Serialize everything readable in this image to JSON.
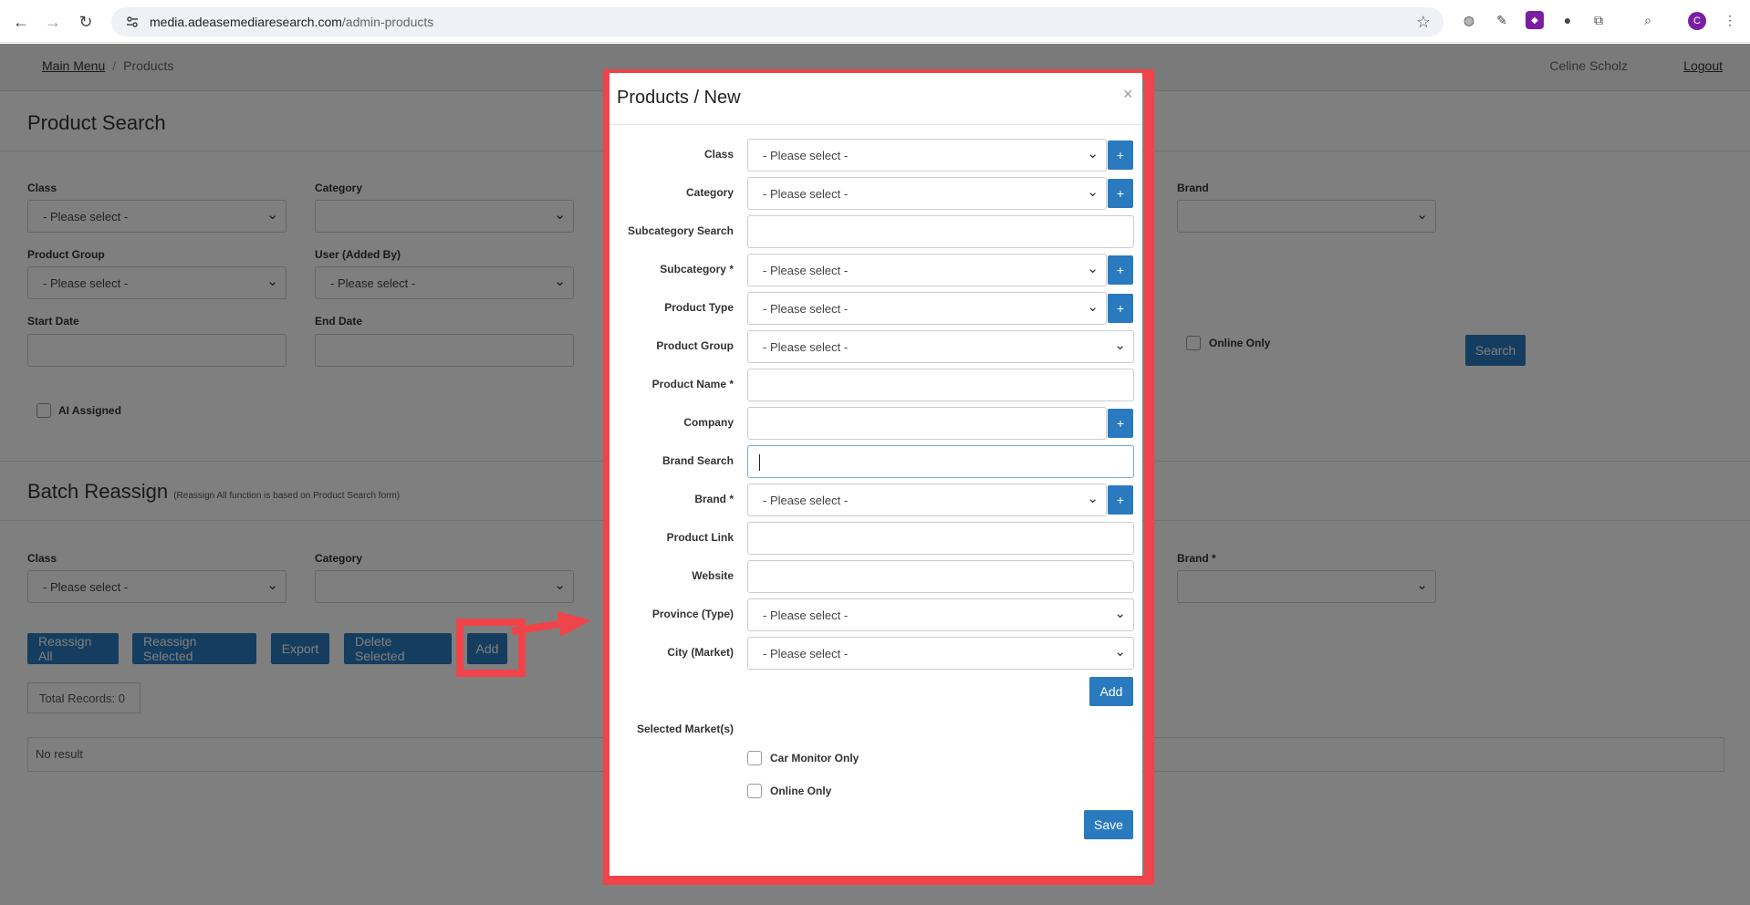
{
  "browser": {
    "url_host": "media.adeasemediaresearch.com",
    "url_path": "/admin-products",
    "avatar_letter": "C"
  },
  "topnav": {
    "main_menu": "Main Menu",
    "current": "Products",
    "user": "Celine Scholz",
    "logout": "Logout"
  },
  "product_search": {
    "title": "Product Search",
    "class_label": "Class",
    "class_value": "- Please select -",
    "category_label": "Category",
    "brand_label": "Brand",
    "product_group_label": "Product Group",
    "product_group_value": "- Please select -",
    "user_label": "User (Added By)",
    "user_value": "- Please select -",
    "start_date_label": "Start Date",
    "end_date_label": "End Date",
    "online_only": "Online Only",
    "search_button": "Search",
    "ai_assigned": "AI Assigned"
  },
  "batch_reassign": {
    "title": "Batch Reassign",
    "subtitle": "(Reassign All function is based on Product Search form)",
    "class_label": "Class",
    "class_value": "- Please select -",
    "category_label": "Category",
    "brand_label": "Brand *",
    "reassign_all": "Reassign All",
    "reassign_selected": "Reassign Selected",
    "export": "Export",
    "delete_selected": "Delete Selected",
    "add": "Add",
    "total_records": "Total Records: 0",
    "no_result": "No result"
  },
  "modal": {
    "title": "Products / New",
    "close": "×",
    "class_label": "Class",
    "category_label": "Category",
    "subcategory_search_label": "Subcategory Search",
    "subcategory_label": "Subcategory *",
    "product_type_label": "Product Type",
    "product_group_label": "Product Group",
    "product_name_label": "Product Name *",
    "company_label": "Company",
    "brand_search_label": "Brand Search",
    "brand_label": "Brand *",
    "product_link_label": "Product Link",
    "website_label": "Website",
    "province_label": "Province (Type)",
    "city_label": "City (Market)",
    "please_select": "- Please select -",
    "plus": "+",
    "add_button": "Add",
    "selected_markets_label": "Selected Market(s)",
    "car_monitor_only": "Car Monitor Only",
    "online_only": "Online Only",
    "save_button": "Save"
  },
  "colors": {
    "primary": "#2a7abf",
    "highlight": "#f0444a"
  }
}
